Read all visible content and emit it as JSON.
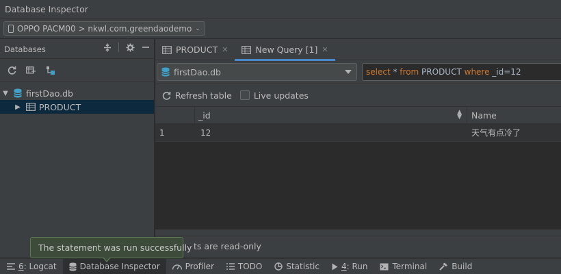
{
  "window": {
    "title": "Database Inspector"
  },
  "device": {
    "label": "OPPO PACM00 > nkwl.com.greendaodemo"
  },
  "left_panel": {
    "title": "Databases",
    "tree": [
      {
        "label": "firstDao.db",
        "type": "database",
        "expanded": true
      },
      {
        "label": "PRODUCT",
        "type": "table",
        "expanded": false,
        "selected": true
      }
    ]
  },
  "tabs": [
    {
      "label": "PRODUCT",
      "active": false
    },
    {
      "label": "New Query [1]",
      "active": true
    }
  ],
  "query": {
    "database": "firstDao.db",
    "sql_tokens": {
      "t1": "select",
      "t2": " * ",
      "t3": "from",
      "t4": " PRODUCT ",
      "t5": "where",
      "t6": " _id=12"
    }
  },
  "actions": {
    "refresh": "Refresh table",
    "live_updates": "Live updates"
  },
  "grid": {
    "columns": [
      "_id",
      "Name"
    ],
    "rows": [
      {
        "index": "1",
        "id": "12",
        "name": "天气有点冷了"
      }
    ]
  },
  "status": {
    "text": "ts are read-only"
  },
  "toast": {
    "message": "The statement was run successfully"
  },
  "bottom_tools": {
    "logcat_num": "6",
    "logcat": ": Logcat",
    "db_inspector": "Database Inspector",
    "profiler": "Profiler",
    "todo": "TODO",
    "statistic": "Statistic",
    "run_num": "4",
    "run": ": Run",
    "terminal": "Terminal",
    "build": "Build"
  },
  "colors": {
    "panel_bg": "#3c3f41",
    "editor_bg": "#2b2b2b",
    "accent": "#4a88c7",
    "keyword": "#cc7832",
    "db_icon": "#40a0c8",
    "toast_bg": "#3d4b3a"
  }
}
